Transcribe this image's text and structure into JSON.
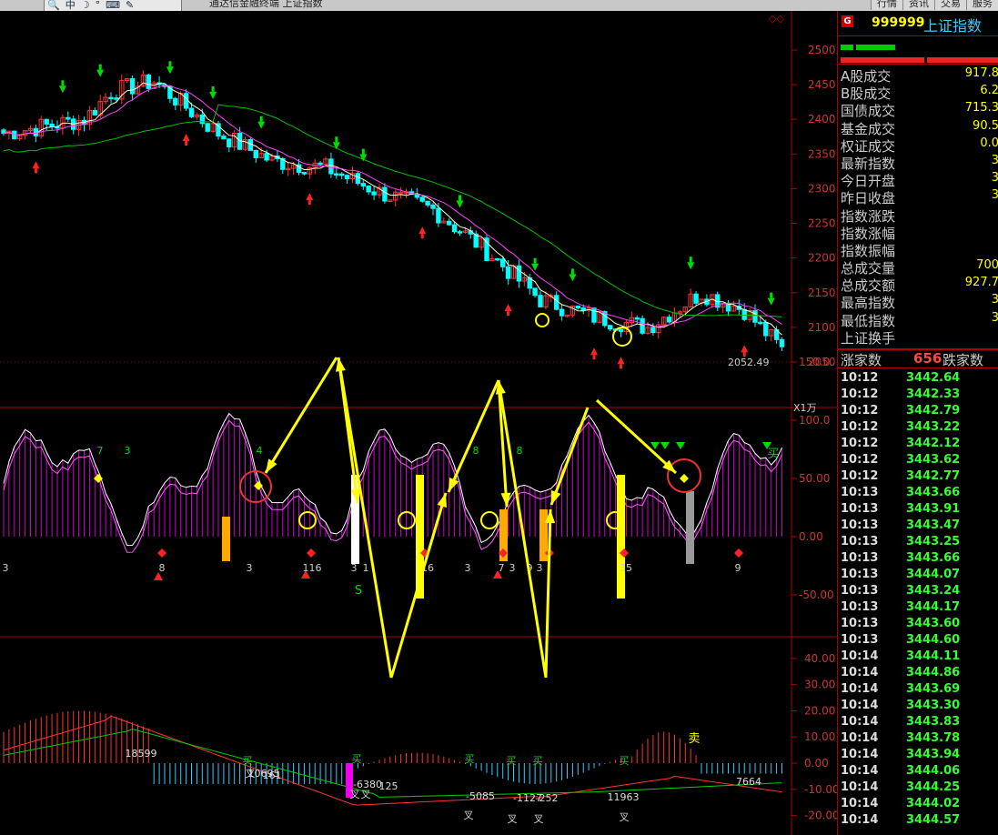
{
  "toolbar": {
    "icons": [
      "search-icon",
      "chinese-input-icon",
      "moon-icon",
      "dots-icon",
      "keyboard-icon",
      "tool-icon"
    ],
    "im_label": "中",
    "title": "通达信金融终端 上证指数"
  },
  "tabs": [
    "行情",
    "资讯",
    "交易",
    "服务"
  ],
  "panel": {
    "g_badge": "G",
    "code": "999999",
    "name": "上证指数",
    "stats": [
      {
        "label": "A股成交",
        "value": "917.8"
      },
      {
        "label": "B股成交",
        "value": "6.2"
      },
      {
        "label": "国债成交",
        "value": "715.3"
      },
      {
        "label": "基金成交",
        "value": "90.5"
      },
      {
        "label": "权证成交",
        "value": "0.0"
      },
      {
        "label": "最新指数",
        "value": "3"
      },
      {
        "label": "今日开盘",
        "value": "3"
      },
      {
        "label": "昨日收盘",
        "value": "3"
      },
      {
        "label": "指数涨跌",
        "value": ""
      },
      {
        "label": "指数涨幅",
        "value": ""
      },
      {
        "label": "指数振幅",
        "value": ""
      },
      {
        "label": "总成交量",
        "value": "700"
      },
      {
        "label": "总成交额",
        "value": "927.7"
      },
      {
        "label": "最高指数",
        "value": "3"
      },
      {
        "label": "最低指数",
        "value": "3"
      },
      {
        "label": "上证换手",
        "value": ""
      }
    ],
    "up_label": "涨家数",
    "up_count": "656",
    "down_label": "跌家数",
    "ticks": [
      {
        "time": "10:12",
        "price": "3442.64"
      },
      {
        "time": "10:12",
        "price": "3442.33"
      },
      {
        "time": "10:12",
        "price": "3442.79"
      },
      {
        "time": "10:12",
        "price": "3443.22"
      },
      {
        "time": "10:12",
        "price": "3442.12"
      },
      {
        "time": "10:12",
        "price": "3443.62"
      },
      {
        "time": "10:12",
        "price": "3442.77"
      },
      {
        "time": "10:13",
        "price": "3443.66"
      },
      {
        "time": "10:13",
        "price": "3443.91"
      },
      {
        "time": "10:13",
        "price": "3443.47"
      },
      {
        "time": "10:13",
        "price": "3443.25"
      },
      {
        "time": "10:13",
        "price": "3443.66"
      },
      {
        "time": "10:13",
        "price": "3444.07"
      },
      {
        "time": "10:13",
        "price": "3443.24"
      },
      {
        "time": "10:13",
        "price": "3444.17"
      },
      {
        "time": "10:13",
        "price": "3443.60"
      },
      {
        "time": "10:13",
        "price": "3444.60"
      },
      {
        "time": "10:14",
        "price": "3444.11"
      },
      {
        "time": "10:14",
        "price": "3444.86"
      },
      {
        "time": "10:14",
        "price": "3443.69"
      },
      {
        "time": "10:14",
        "price": "3443.30"
      },
      {
        "time": "10:14",
        "price": "3443.83"
      },
      {
        "time": "10:14",
        "price": "3443.78"
      },
      {
        "time": "10:14",
        "price": "3443.94"
      },
      {
        "time": "10:14",
        "price": "3444.06"
      },
      {
        "time": "10:14",
        "price": "3444.25"
      },
      {
        "time": "10:14",
        "price": "3444.02"
      },
      {
        "time": "10:14",
        "price": "3444.57"
      }
    ]
  },
  "chart": {
    "price_axis": [
      "2500",
      "2450",
      "2400",
      "2350",
      "2300",
      "2250",
      "2200",
      "2150",
      "2100",
      "2050"
    ],
    "last_price": "2052.49",
    "unit_label": "X1万",
    "ind_axis": [
      "150.0",
      "100.0",
      "50.00",
      "0.00",
      "-50.00"
    ],
    "macd_axis": [
      "40.00",
      "30.00",
      "20.00",
      "10.00",
      "0.00",
      "-10.00",
      "-20.00"
    ],
    "top_labels": [
      "7",
      "3",
      "4",
      "8",
      "8"
    ],
    "bottom_labels": [
      "3",
      "8",
      "3",
      "116",
      "3",
      "1",
      "16",
      "3",
      "7",
      "3",
      "9",
      "3",
      "35",
      "9"
    ],
    "s_label": "S",
    "macd_labels": [
      "18599",
      "10695",
      "161",
      "-6380",
      "125",
      "-5085",
      "-1127",
      "-252",
      "11963",
      "7664"
    ],
    "buy": "买",
    "sell": "卖",
    "cross": "叉",
    "colors": {
      "up": "#ff3232",
      "down": "#00ffff",
      "ma5": "#ffffcc",
      "ma10": "#ff40ff",
      "ma30": "#00c000",
      "arrow": "#ffff00"
    }
  }
}
